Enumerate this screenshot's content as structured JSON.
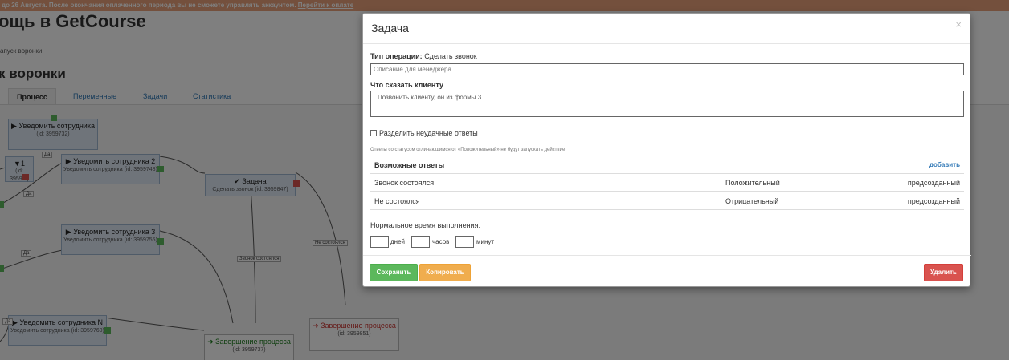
{
  "banner": {
    "text": "до 26 Августа. После окончания оплаченного периода вы не сможете управлять аккаунтом.",
    "link": "Перейти к оплате"
  },
  "page": {
    "title": "ощь в GetCourse",
    "breadcrumb": "апуск воронки",
    "subtitle": "к воронки"
  },
  "tabs": [
    "Процесс",
    "Переменные",
    "Задачи",
    "Статистика"
  ],
  "nodes": [
    {
      "title": "▶ Уведомить сотрудника",
      "sub": "(id: 3959732)"
    },
    {
      "title": "▶ Уведомить сотрудника 2",
      "sub": "Уведомить сотрудника (id: 3959748)"
    },
    {
      "title": "✔ Задача",
      "sub": "Сделать звонок (id: 3959847)"
    },
    {
      "title": "▶ Уведомить сотрудника 3",
      "sub": "Уведомить сотрудника (id: 3959755)"
    },
    {
      "title": "▶ Уведомить сотрудника N",
      "sub": "Уведомить сотрудника (id: 3959760)"
    },
    {
      "title": "➜ Завершение процесса",
      "sub": "(id: 3959737)"
    },
    {
      "title": "➜ Завершение процесса",
      "sub": "(id: 3959851)"
    },
    {
      "title": "▼1",
      "sub": "(id: 3959...)"
    }
  ],
  "edge_labels": [
    "Да",
    "Да",
    "Да",
    "Да",
    "Звонок состоялся",
    "Не состоялся"
  ],
  "modal": {
    "title": "Задача",
    "close": "×",
    "op_type_label": "Тип операции:",
    "op_type_value": "Сделать звонок",
    "manager_placeholder": "Описание для менеджера",
    "say_label": "Что сказать клиенту",
    "say_value": "Позвонить клиенту, он из формы 3",
    "split_label": "Разделить неудачные ответы",
    "hint": "Ответы со статусом отличающимся от «Положительный» не будут запускать действие",
    "answers_title": "Возможные ответы",
    "add": "добавить",
    "answers": [
      {
        "text": "Звонок состоялся",
        "status": "Положительный",
        "kind": "предсозданный"
      },
      {
        "text": "Не состоялся",
        "status": "Отрицательный",
        "kind": "предсозданный"
      }
    ],
    "time_label": "Нормальное время выполнения:",
    "days": "дней",
    "hours": "часов",
    "minutes": "минут",
    "save": "Сохранить",
    "copy": "Копировать",
    "delete": "Удалить"
  },
  "colors": {
    "banner": "#e8a07a",
    "save": "#5cb85c",
    "copy": "#f0ad4e",
    "delete": "#d9534f",
    "link": "#337ab7"
  }
}
